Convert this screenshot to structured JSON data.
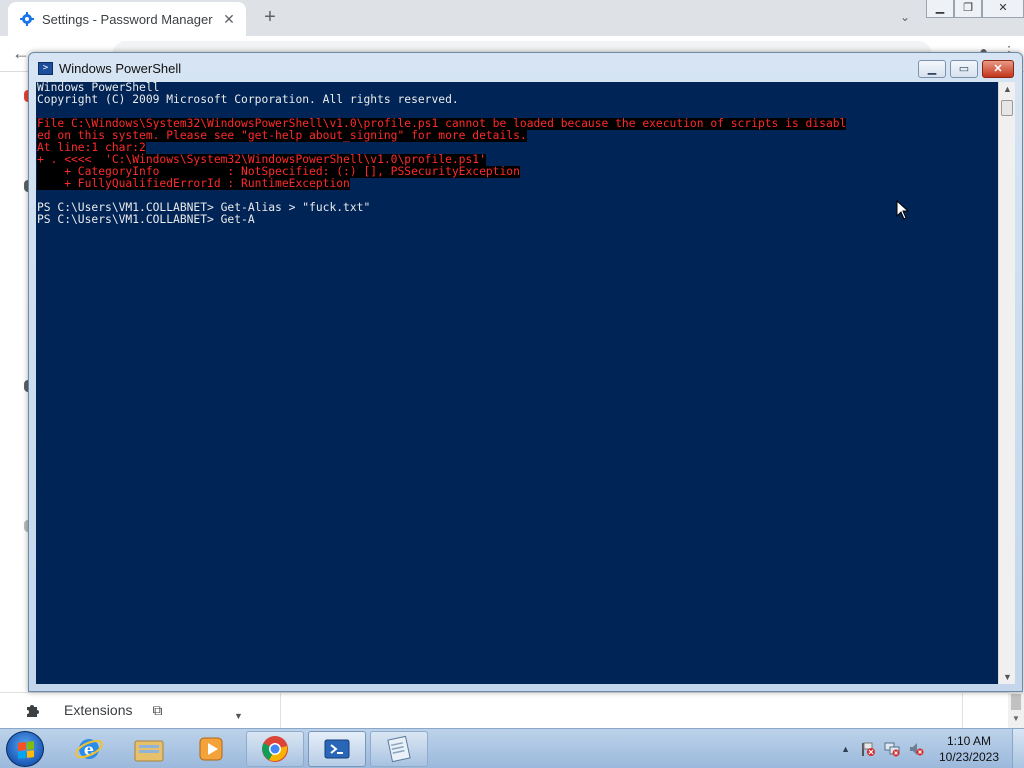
{
  "browser": {
    "tab_title": "Settings - Password Manager",
    "new_tab_symbol": "+",
    "tab_close_symbol": "✕",
    "tab_search_symbol": "⌄",
    "window_controls": [
      "▁",
      "❐",
      "✕"
    ],
    "sidebar_bottom": {
      "extensions_label": "Extensions",
      "open_icon": "⧉"
    }
  },
  "powershell": {
    "window_title": "Windows PowerShell",
    "controls": {
      "minimize": "▁",
      "maximize": "▭",
      "close": "✕"
    },
    "console_lines": [
      {
        "kind": "out",
        "text": "Windows PowerShell"
      },
      {
        "kind": "out",
        "text": "Copyright (C) 2009 Microsoft Corporation. All rights reserved."
      },
      {
        "kind": "blank",
        "text": ""
      },
      {
        "kind": "err",
        "text": "File C:\\Windows\\System32\\WindowsPowerShell\\v1.0\\profile.ps1 cannot be loaded because the execution of scripts is disabl"
      },
      {
        "kind": "err",
        "text": "ed on this system. Please see \"get-help about_signing\" for more details."
      },
      {
        "kind": "err",
        "text": "At line:1 char:2"
      },
      {
        "kind": "err",
        "text": "+ . <<<<  'C:\\Windows\\System32\\WindowsPowerShell\\v1.0\\profile.ps1'"
      },
      {
        "kind": "err",
        "text": "    + CategoryInfo          : NotSpecified: (:) [], PSSecurityException"
      },
      {
        "kind": "err",
        "text": "    + FullyQualifiedErrorId : RuntimeException"
      },
      {
        "kind": "blank",
        "text": ""
      },
      {
        "kind": "out",
        "text": "PS C:\\Users\\VM1.COLLABNET> Get-Alias > \"fuck.txt\""
      },
      {
        "kind": "out",
        "text": "PS C:\\Users\\VM1.COLLABNET> Get-A"
      }
    ]
  },
  "taskbar": {
    "apps": [
      {
        "name": "internet-explorer"
      },
      {
        "name": "windows-explorer"
      },
      {
        "name": "media-player"
      },
      {
        "name": "google-chrome"
      },
      {
        "name": "powershell"
      },
      {
        "name": "notepad"
      }
    ],
    "clock_time": "1:10 AM",
    "clock_date": "10/23/2023",
    "tray_chevron": "▲"
  },
  "colors": {
    "console_bg": "#012456",
    "console_fg": "#ececec",
    "error_fg": "#ff2a2a",
    "error_bg": "#000000"
  }
}
